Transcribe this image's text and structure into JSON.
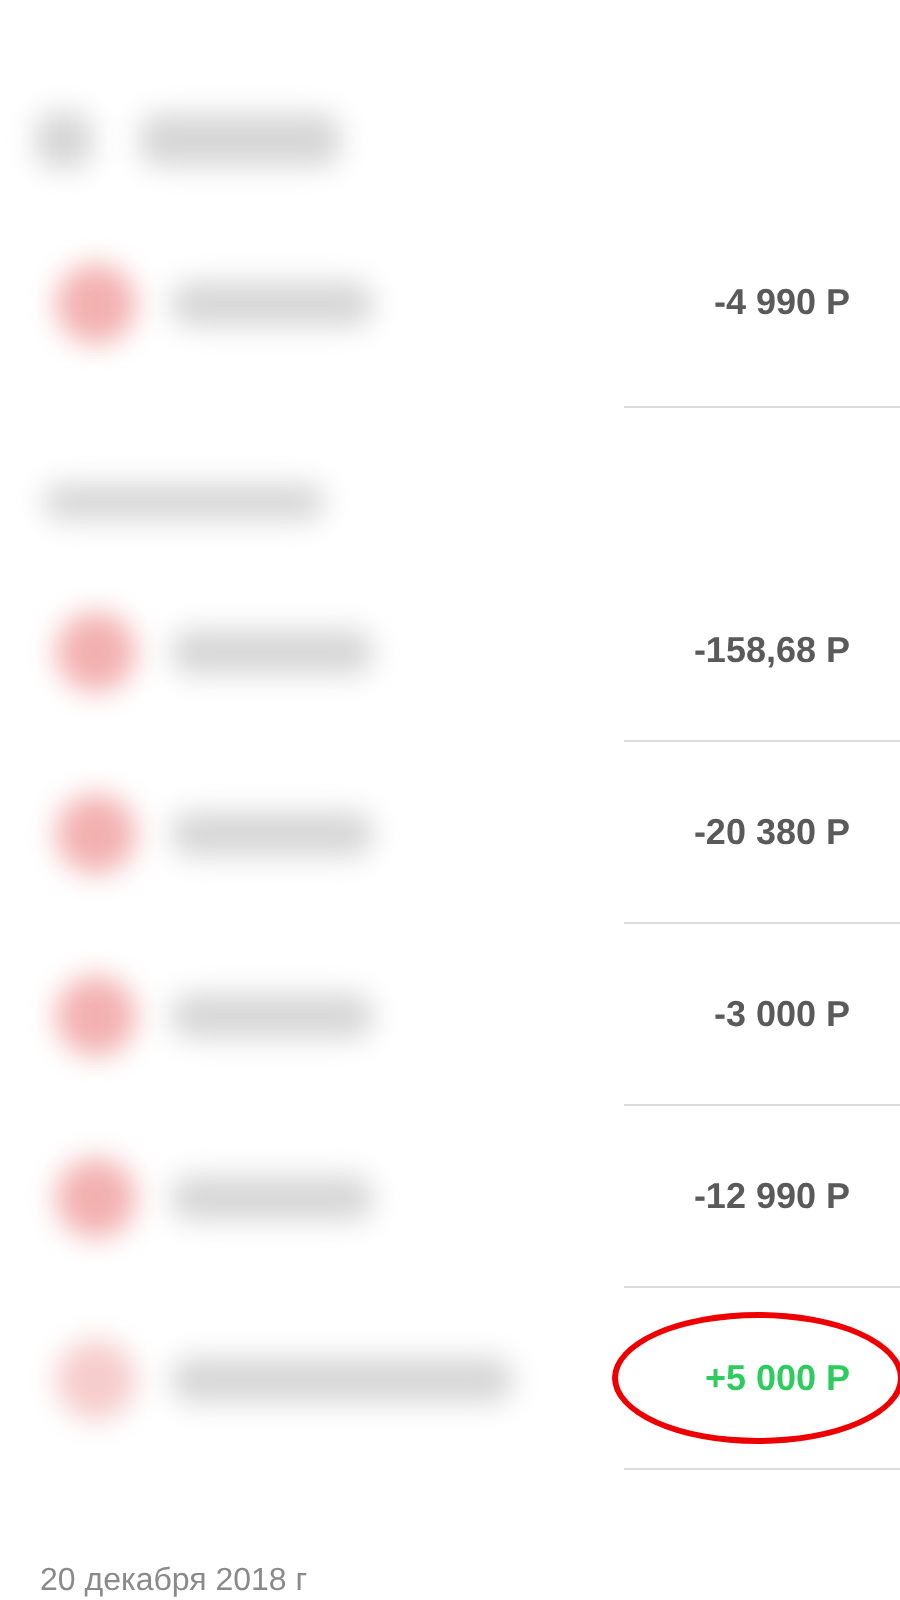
{
  "groups": [
    {
      "transactions": [
        {
          "amount": "-4 990 Р",
          "kind": "expense",
          "highlighted": false
        }
      ]
    },
    {
      "transactions": [
        {
          "amount": "-158,68 Р",
          "kind": "expense",
          "highlighted": false
        },
        {
          "amount": "-20 380 Р",
          "kind": "expense",
          "highlighted": false
        },
        {
          "amount": "-3 000 Р",
          "kind": "expense",
          "highlighted": false
        },
        {
          "amount": "-12 990 Р",
          "kind": "expense",
          "highlighted": false
        },
        {
          "amount": "+5 000 Р",
          "kind": "income",
          "highlighted": true
        }
      ]
    }
  ],
  "date_header": "20 декабря 2018 г"
}
